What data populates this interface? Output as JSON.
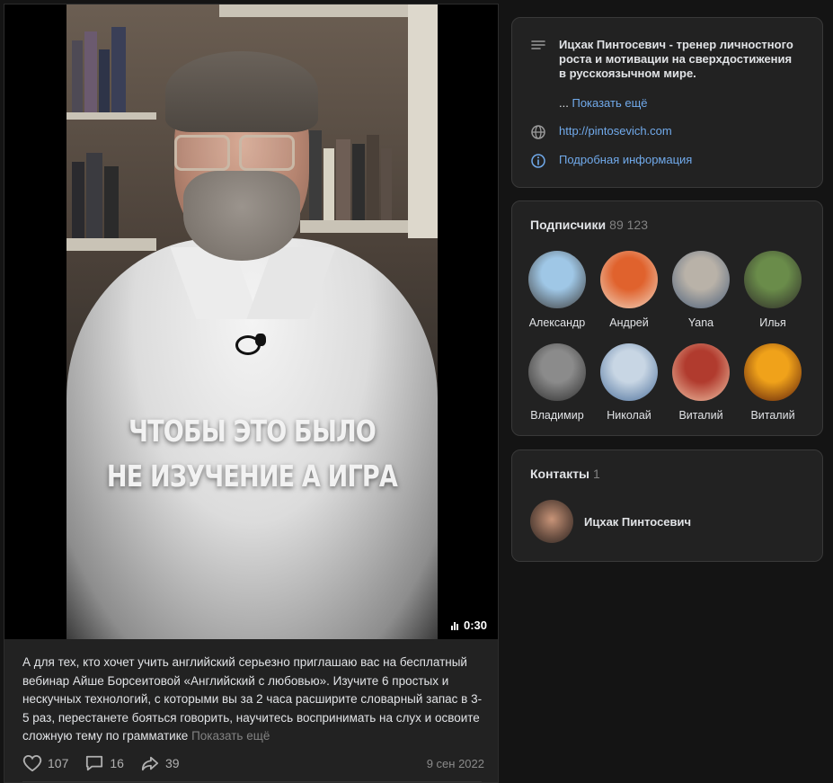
{
  "video": {
    "caption_line1": "ЧТОБЫ ЭТО БЫЛО",
    "caption_line2": "НЕ ИЗУЧЕНИЕ А ИГРА",
    "duration": "0:30"
  },
  "post": {
    "text": "А для тех, кто хочет учить английский серьезно приглашаю вас на бесплатный вебинар Айше Борсеитовой «Английский с любовью». Изучите 6 простых и нескучных технологий, с которыми вы за 2 часа расширите словарный запас в 3-5 раз, перестанете бояться говорить, научитесь воспринимать на слух и освоите сложную тему по грамматике",
    "show_more": "Показать ещё",
    "likes": "107",
    "comments": "16",
    "shares": "39",
    "date": "9 сен 2022"
  },
  "info": {
    "description": "Ицхак Пинтосевич - тренер личностного роста и мотивации на сверхдостижения в русскоязычном мире.",
    "ellipsis": "...",
    "show_more": "Показать ещё",
    "website": "http://pintosevich.com",
    "details": "Подробная информация"
  },
  "subscribers": {
    "title": "Подписчики",
    "count": "89 123",
    "items": [
      {
        "name": "Александр",
        "colors": [
          "#9fc7e6",
          "#3c3a38"
        ]
      },
      {
        "name": "Андрей",
        "colors": [
          "#e0622d",
          "#f1d7c2"
        ]
      },
      {
        "name": "Yana",
        "colors": [
          "#b9b2a8",
          "#4b5f7a"
        ]
      },
      {
        "name": "Илья",
        "colors": [
          "#6a8c4a",
          "#2d2a28"
        ]
      },
      {
        "name": "Владимир",
        "colors": [
          "#8b8b8b",
          "#2c2c2c"
        ]
      },
      {
        "name": "Николай",
        "colors": [
          "#c8d6e4",
          "#4a6e9a"
        ]
      },
      {
        "name": "Виталий",
        "colors": [
          "#b13b2e",
          "#f0c3a6"
        ]
      },
      {
        "name": "Виталий",
        "colors": [
          "#f0a21a",
          "#5a1c0a"
        ]
      }
    ]
  },
  "contacts": {
    "title": "Контакты",
    "count": "1",
    "items": [
      {
        "name": "Ицхак Пинтосевич"
      }
    ]
  }
}
